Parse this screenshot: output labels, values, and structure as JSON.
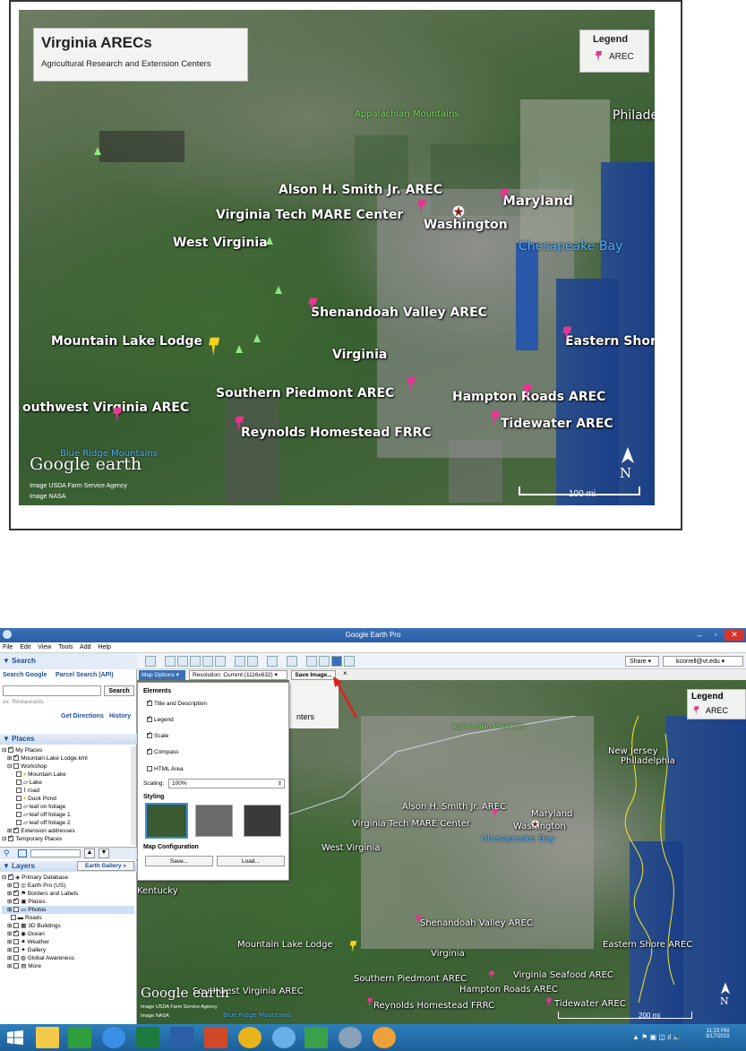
{
  "top_map": {
    "title": "Virginia ARECs",
    "subtitle": "Agricultural Research and Extension Centers",
    "legend_title": "Legend",
    "legend_item": "AREC",
    "labels": {
      "appalachian": "Appalachian Mountains",
      "phila": "Philade",
      "alson": "Alson H. Smith Jr. AREC",
      "mare": "Virginia Tech MARE Center",
      "maryland": "Maryland",
      "washington": "Washington",
      "chesapeake": "Chesapeake Bay",
      "wv": "West Virginia",
      "shenandoah": "Shenandoah Valley AREC",
      "mll": "Mountain Lake Lodge",
      "virginia": "Virginia",
      "eastern": "Eastern Shor",
      "southern": "Southern Piedmont AREC",
      "hampton": "Hampton Roads AREC",
      "southwest": "outhwest Virginia AREC",
      "tidewater": "Tidewater AREC",
      "reynolds": "Reynolds Homestead FRRC",
      "blueridge": "Blue Ridge Mountains"
    },
    "brand": "Google earth",
    "credit1": "Image USDA Farm Service Agency",
    "credit2": "Image NASA",
    "scale": "100 mi",
    "north": "N"
  },
  "app": {
    "window_title": "Google Earth Pro",
    "menu": [
      "File",
      "Edit",
      "View",
      "Tools",
      "Add",
      "Help"
    ],
    "share": "Share",
    "account": "kcorrell@vt.edu",
    "search_header": "▼ Search",
    "search_tab1": "Search Google",
    "search_tab2": "Parcel Search (API)",
    "search_btn": "Search",
    "search_placeholder": "ex: Restaurants",
    "get_directions": "Get Directions",
    "history": "History",
    "places_header": "▼ Places",
    "places": [
      "My Places",
      "Mountain Lake Lodge.kml",
      "Workshop",
      "Mountain Lake",
      "Lake",
      "road",
      "Duck Pond",
      "leaf on foliage",
      "leaf off foliage 1",
      "leaf off foliage 2",
      "Extension addresses",
      "Temporary Places"
    ],
    "layers_header": "▼ Layers",
    "earth_gallery": "Earth Gallery »",
    "layers": [
      "Primary Database",
      "Earth Pro (US)",
      "Borders and Labels",
      "Places",
      "Photos",
      "Roads",
      "3D Buildings",
      "Ocean",
      "Weather",
      "Gallery",
      "Global Awareness",
      "More"
    ],
    "map_options": "Map Options",
    "resolution": "Resolution: Current (1116x632)",
    "save_image": "Save Image...",
    "close_x": "×",
    "elements_header": "Elements",
    "elements": [
      "Title and Description",
      "Legend",
      "Scale",
      "Compass",
      "HTML Area"
    ],
    "scaling_label": "Scaling:",
    "scaling_value": "100%",
    "styling_header": "Styling",
    "mapconfig_header": "Map Configuration",
    "save_btn": "Save...",
    "load_btn": "Load...",
    "map_labels": {
      "legend_title": "Legend",
      "legend_item": "AREC",
      "enters": "nters",
      "appalachian": "Appalachian Mountains",
      "nj": "New Jersey",
      "phila": "Philadelphia",
      "alson": "Alson H. Smith Jr. AREC",
      "mare": "Virginia Tech MARE Center",
      "maryland": "Maryland",
      "washington": "Washington",
      "chesapeake": "Chesapeake Bay",
      "wv": "West Virginia",
      "kentucky": "Kentucky",
      "shenandoah": "Shenandoah Valley AREC",
      "mll": "Mountain Lake Lodge",
      "virginia": "Virginia",
      "eastern": "Eastern Shore AREC",
      "southern": "Southern Piedmont AREC",
      "seafood": "Virginia Seafood AREC",
      "hampton": "Hampton Roads AREC",
      "southwest": "Southwest Virginia AREC",
      "reynolds": "Reynolds Homestead FRRC",
      "tidewater": "Tidewater AREC",
      "blueridge": "Blue Ridge Mountains",
      "brand": "Google earth",
      "credit1": "Image USDA Farm Service Agency",
      "credit2": "Image NASA",
      "scale": "200 mi",
      "north": "N"
    },
    "clock_time": "11:23 PM",
    "clock_date": "3/17/2015",
    "colors": {
      "accent": "#2b5ea6",
      "pin": "#e6368f",
      "place_pin": "#f2d21b"
    }
  }
}
